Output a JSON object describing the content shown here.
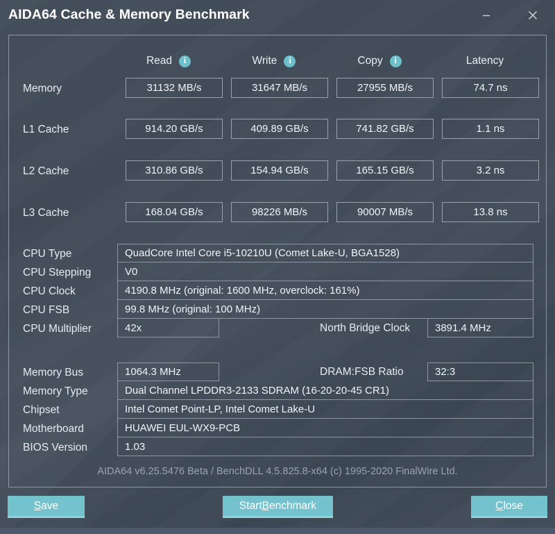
{
  "window": {
    "title": "AIDA64 Cache & Memory Benchmark",
    "minimize_label": "–",
    "close_label": "×"
  },
  "colors": {
    "accent": "#74c2cd",
    "accent_underline": "#8ed2da",
    "background": "#3f4a57",
    "border": "#8e97a1",
    "text": "#e9edf2",
    "muted_text": "#9aa4b0"
  },
  "benchmark": {
    "columns": [
      {
        "label": "Read",
        "has_info": true
      },
      {
        "label": "Write",
        "has_info": true
      },
      {
        "label": "Copy",
        "has_info": true
      },
      {
        "label": "Latency",
        "has_info": false
      }
    ],
    "rows": [
      {
        "label": "Memory",
        "read": "31132 MB/s",
        "write": "31647 MB/s",
        "copy": "27955 MB/s",
        "latency": "74.7 ns"
      },
      {
        "label": "L1 Cache",
        "read": "914.20 GB/s",
        "write": "409.89 GB/s",
        "copy": "741.82 GB/s",
        "latency": "1.1 ns"
      },
      {
        "label": "L2 Cache",
        "read": "310.86 GB/s",
        "write": "154.94 GB/s",
        "copy": "165.15 GB/s",
        "latency": "3.2 ns"
      },
      {
        "label": "L3 Cache",
        "read": "168.04 GB/s",
        "write": "98226 MB/s",
        "copy": "90007 MB/s",
        "latency": "13.8 ns"
      }
    ]
  },
  "cpu_info": {
    "cpu_type": {
      "label": "CPU Type",
      "value": "QuadCore Intel Core i5-10210U  (Comet Lake-U, BGA1528)"
    },
    "cpu_stepping": {
      "label": "CPU Stepping",
      "value": "V0"
    },
    "cpu_clock": {
      "label": "CPU Clock",
      "value": "4190.8 MHz  (original: 1600 MHz, overclock: 161%)"
    },
    "cpu_fsb": {
      "label": "CPU FSB",
      "value": "99.8 MHz  (original: 100 MHz)"
    },
    "cpu_multiplier": {
      "label": "CPU Multiplier",
      "value": "42x"
    },
    "north_bridge_clock": {
      "label": "North Bridge Clock",
      "value": "3891.4 MHz"
    }
  },
  "memory_info": {
    "memory_bus": {
      "label": "Memory Bus",
      "value": "1064.3 MHz"
    },
    "dram_fsb_ratio": {
      "label": "DRAM:FSB Ratio",
      "value": "32:3"
    },
    "memory_type": {
      "label": "Memory Type",
      "value": "Dual Channel LPDDR3-2133 SDRAM  (16-20-20-45 CR1)"
    },
    "chipset": {
      "label": "Chipset",
      "value": "Intel Comet Point-LP, Intel Comet Lake-U"
    },
    "motherboard": {
      "label": "Motherboard",
      "value": "HUAWEI EUL-WX9-PCB"
    },
    "bios_version": {
      "label": "BIOS Version",
      "value": "1.03"
    }
  },
  "credit": "AIDA64 v6.25.5476 Beta / BenchDLL 4.5.825.8-x64  (c) 1995-2020 FinalWire Ltd.",
  "buttons": {
    "save": {
      "pre": "",
      "accel": "S",
      "post": "ave"
    },
    "start_benchmark": {
      "pre": "Start ",
      "accel": "B",
      "post": "enchmark"
    },
    "close": {
      "pre": "",
      "accel": "C",
      "post": "lose"
    }
  }
}
